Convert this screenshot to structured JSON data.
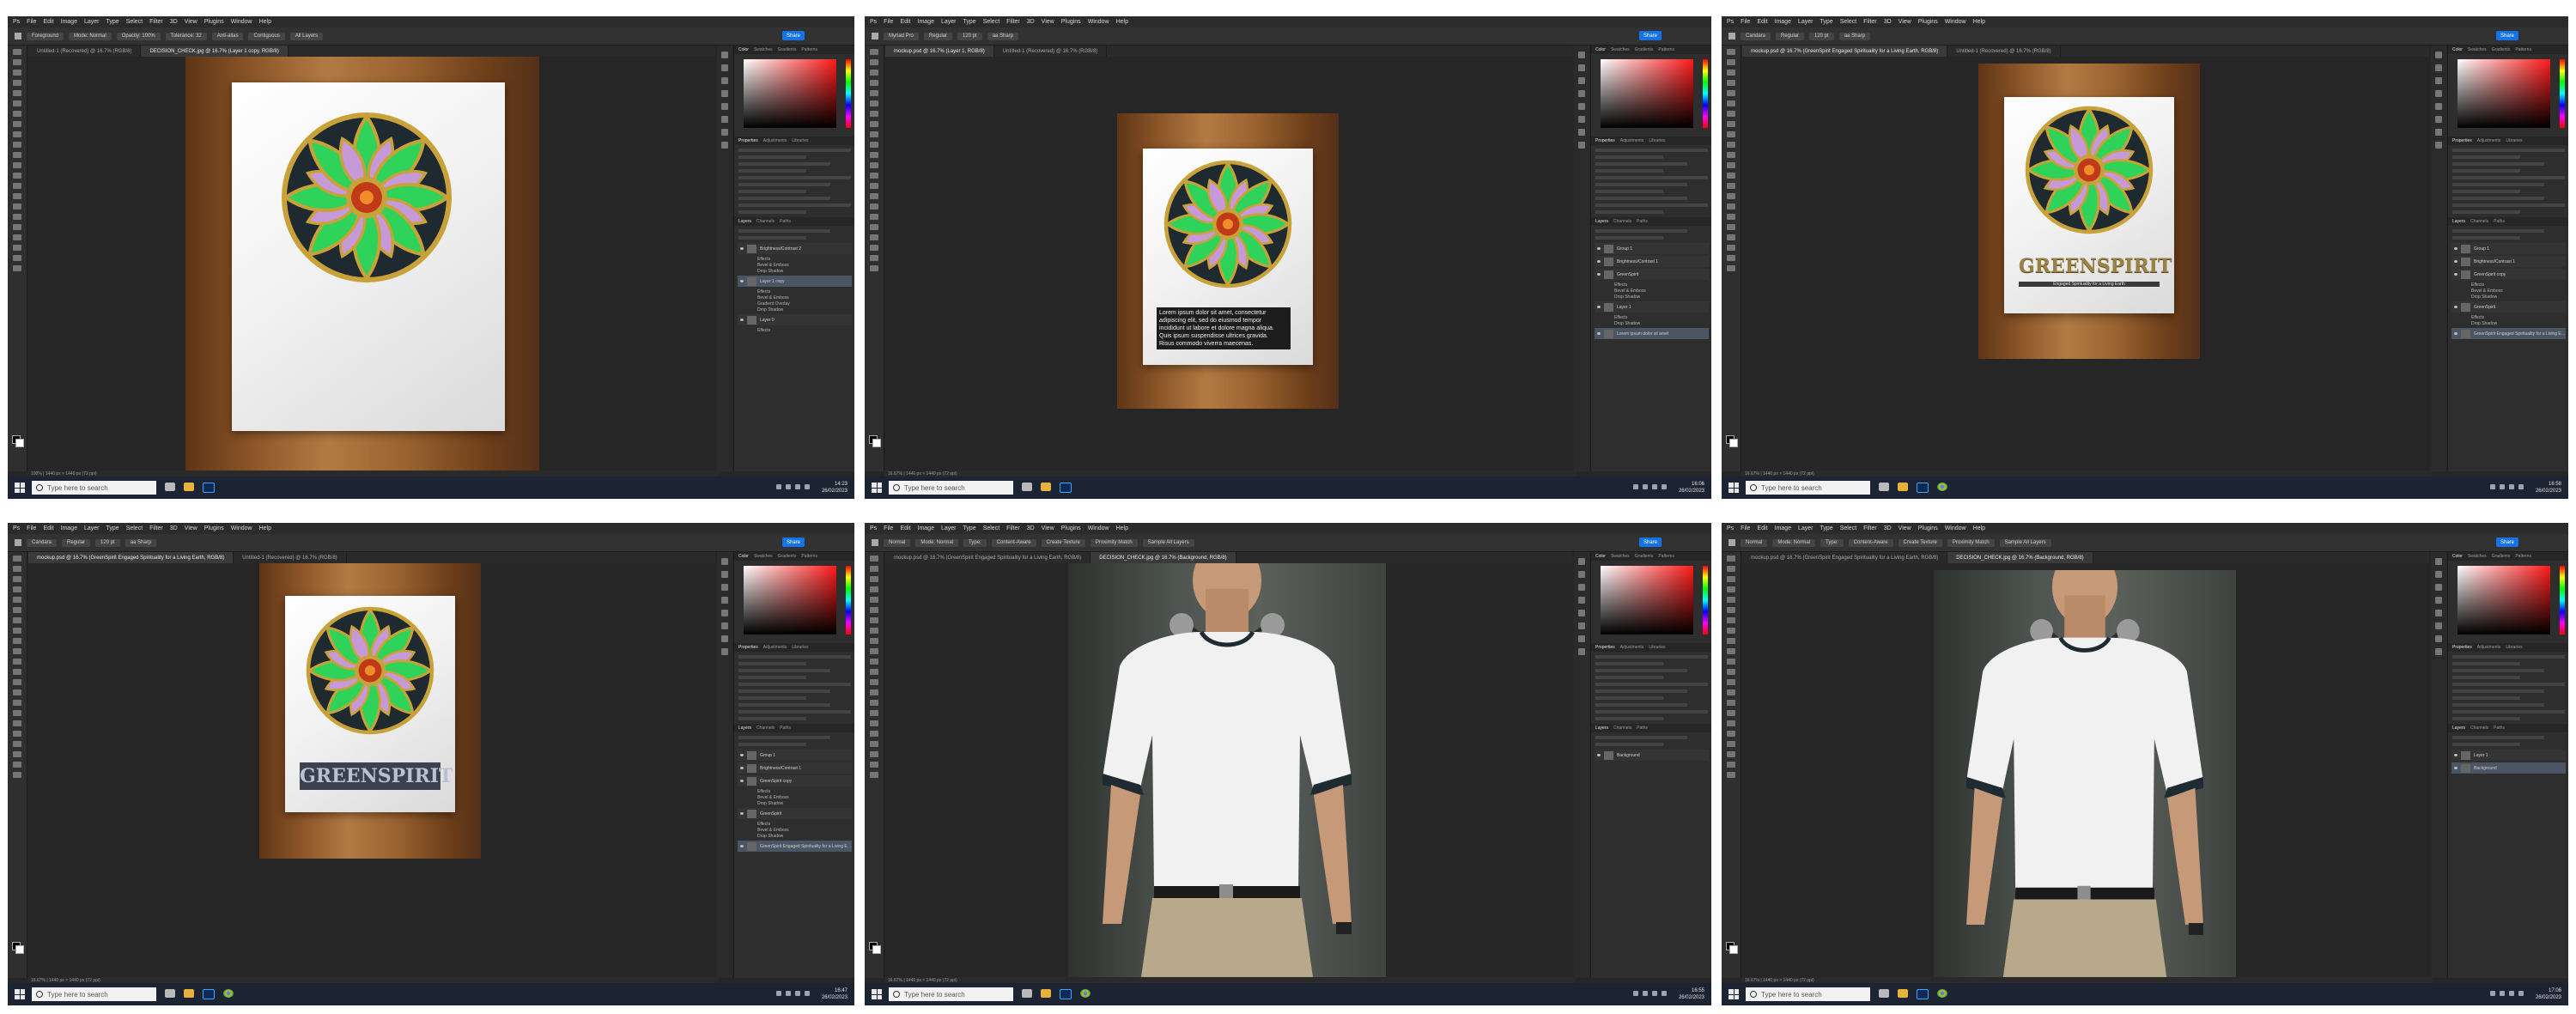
{
  "screenshots": [
    {
      "layout_id": "tl",
      "menu": [
        "Ps",
        "File",
        "Edit",
        "Image",
        "Layer",
        "Type",
        "Select",
        "Filter",
        "3D",
        "View",
        "Plugins",
        "Window",
        "Help"
      ],
      "options": [
        "Foreground",
        "Mode: Normal",
        "Opacity: 100%",
        "Tolerance: 32",
        "Anti-alias",
        "Contiguous",
        "All Layers"
      ],
      "share": "Share",
      "tabs": [
        "Untitled-1 (Recovered) @ 16.7% (RGB/8)",
        "DECISION_CHECK.jpg @ 16.7% (Layer 1 copy, RGB/8)"
      ],
      "active_tab": 1,
      "status": "100% | 1440 px × 1440 px (72 ppi)",
      "panel_tabs": [
        "Color",
        "Swatches",
        "Gradients",
        "Patterns"
      ],
      "props_tabs": [
        "Properties",
        "Adjustments",
        "Libraries"
      ],
      "layer_tabs": [
        "Layers",
        "Channels",
        "Paths"
      ],
      "layers": [
        {
          "name": "Brightness/Contrast 2",
          "sel": false
        },
        {
          "name": "Effects",
          "sub": true
        },
        {
          "name": "Bevel & Emboss",
          "sub": true
        },
        {
          "name": "Drop Shadow",
          "sub": true
        },
        {
          "name": "Layer 1 copy",
          "sel": true
        },
        {
          "name": "Effects",
          "sub": true
        },
        {
          "name": "Bevel & Emboss",
          "sub": true
        },
        {
          "name": "Gradient Overlay",
          "sub": true
        },
        {
          "name": "Drop Shadow",
          "sub": true
        },
        {
          "name": "Layer 0",
          "sel": false
        },
        {
          "name": "Effects",
          "sub": true
        }
      ],
      "time": "14:23",
      "date": "26/02/2023"
    },
    {
      "layout_id": "tm",
      "menu": [
        "Ps",
        "File",
        "Edit",
        "Image",
        "Layer",
        "Type",
        "Select",
        "Filter",
        "3D",
        "View",
        "Plugins",
        "Window",
        "Help"
      ],
      "options": [
        "Myriad Pro",
        "Regular",
        "120 pt",
        "aa Sharp"
      ],
      "share": "Share",
      "tabs": [
        "mockup.psd @ 16.7% (Layer 1, RGB/8)",
        "Untitled-1 (Recovered) @ 16.7% (RGB/8)"
      ],
      "active_tab": 0,
      "status": "16.67% | 1440 px × 1440 px (72 ppi)",
      "panel_tabs": [
        "Color",
        "Swatches",
        "Gradients",
        "Patterns"
      ],
      "props_tabs": [
        "Properties",
        "Adjustments",
        "Libraries"
      ],
      "layer_tabs": [
        "Layers",
        "Channels",
        "Paths"
      ],
      "lorem": "Lorem ipsum dolor sit amet, consectetur\nadipiscing elit, sed do eiusmod tempor\nincididunt ut labore et dolore magna aliqua.\nQuis ipsum suspendisse ultrices gravida.\nRisus commodo viverra maecenas.",
      "layers": [
        {
          "name": "Group 1",
          "sel": false
        },
        {
          "name": "Brightness/Contrast 1",
          "sel": false
        },
        {
          "name": "GreenSpirit",
          "sel": false
        },
        {
          "name": "Effects",
          "sub": true
        },
        {
          "name": "Bevel & Emboss",
          "sub": true
        },
        {
          "name": "Drop Shadow",
          "sub": true
        },
        {
          "name": "Layer 1",
          "sel": false
        },
        {
          "name": "Effects",
          "sub": true
        },
        {
          "name": "Drop Shadow",
          "sub": true
        },
        {
          "name": "Lorem ipsum dolor sit amet",
          "sel": true
        }
      ],
      "time": "16:06",
      "date": "26/02/2023"
    },
    {
      "layout_id": "tr",
      "menu": [
        "Ps",
        "File",
        "Edit",
        "Image",
        "Layer",
        "Type",
        "Select",
        "Filter",
        "3D",
        "View",
        "Plugins",
        "Window",
        "Help"
      ],
      "options": [
        "Candara",
        "Regular",
        "120 pt",
        "aa Sharp"
      ],
      "share": "Share",
      "tabs": [
        "mockup.psd @ 16.7% (GreenSpirit Engaged Spirituality for a Living Earth, RGB/8)",
        "Untitled-1 (Recovered) @ 16.7% (RGB/8)"
      ],
      "active_tab": 0,
      "status": "16.67% | 1440 px × 1440 px (72 ppi)",
      "panel_tabs": [
        "Color",
        "Swatches",
        "Gradients",
        "Patterns"
      ],
      "props_tabs": [
        "Properties",
        "Adjustments",
        "Libraries"
      ],
      "layer_tabs": [
        "Layers",
        "Channels",
        "Paths"
      ],
      "title": "GREENSPIRIT",
      "subtitle": "Engaged Spirituality for a Living Earth",
      "layers": [
        {
          "name": "Group 1",
          "sel": false
        },
        {
          "name": "Brightness/Contrast 1",
          "sel": false
        },
        {
          "name": "GreenSpirit copy",
          "sel": false
        },
        {
          "name": "Effects",
          "sub": true
        },
        {
          "name": "Bevel & Emboss",
          "sub": true
        },
        {
          "name": "Drop Shadow",
          "sub": true
        },
        {
          "name": "GreenSpirit",
          "sel": false
        },
        {
          "name": "Effects",
          "sub": true
        },
        {
          "name": "Drop Shadow",
          "sub": true
        },
        {
          "name": "GreenSpirit Engaged Spirituality for a Living Earth",
          "sel": true
        }
      ],
      "time": "16:58",
      "date": "26/02/2023"
    },
    {
      "layout_id": "bl",
      "menu": [
        "Ps",
        "File",
        "Edit",
        "Image",
        "Layer",
        "Type",
        "Select",
        "Filter",
        "3D",
        "View",
        "Plugins",
        "Window",
        "Help"
      ],
      "options": [
        "Candara",
        "Regular",
        "120 pt",
        "aa Sharp"
      ],
      "share": "Share",
      "tabs": [
        "mockup.psd @ 16.7% (GreenSpirit Engaged Spirituality for a Living Earth, RGB/8)",
        "Untitled-1 (Recovered) @ 16.7% (RGB/8)"
      ],
      "active_tab": 0,
      "status": "16.67% | 1440 px × 1440 px (72 ppi)",
      "panel_tabs": [
        "Color",
        "Swatches",
        "Gradients",
        "Patterns"
      ],
      "props_tabs": [
        "Properties",
        "Adjustments",
        "Libraries"
      ],
      "layer_tabs": [
        "Layers",
        "Channels",
        "Paths"
      ],
      "title": "GREENSPIRIT",
      "subtitle": "",
      "layers": [
        {
          "name": "Group 1",
          "sel": false
        },
        {
          "name": "Brightness/Contrast 1",
          "sel": false
        },
        {
          "name": "GreenSpirit copy",
          "sel": false
        },
        {
          "name": "Effects",
          "sub": true
        },
        {
          "name": "Bevel & Emboss",
          "sub": true
        },
        {
          "name": "Drop Shadow",
          "sub": true
        },
        {
          "name": "GreenSpirit",
          "sel": false
        },
        {
          "name": "Effects",
          "sub": true
        },
        {
          "name": "Bevel & Emboss",
          "sub": true
        },
        {
          "name": "Drop Shadow",
          "sub": true
        },
        {
          "name": "GreenSpirit Engaged Spirituality for a Living Earth",
          "sel": true
        }
      ],
      "time": "16:47",
      "date": "26/02/2023"
    },
    {
      "layout_id": "bm",
      "menu": [
        "Ps",
        "File",
        "Edit",
        "Image",
        "Layer",
        "Type",
        "Select",
        "Filter",
        "3D",
        "View",
        "Plugins",
        "Window",
        "Help"
      ],
      "options": [
        "Normal",
        "Mode: Normal",
        "Type:",
        "Content-Aware",
        "Create Texture",
        "Proximity Match",
        "Sample All Layers"
      ],
      "share": "Share",
      "tabs": [
        "mockup.psd @ 16.7% (GreenSpirit Engaged Spirituality for a Living Earth, RGB/8)",
        "DECISION_CHECK.jpg @ 16.7% (Background, RGB/8)"
      ],
      "active_tab": 1,
      "status": "16.67% | 1440 px × 1440 px (72 ppi)",
      "panel_tabs": [
        "Color",
        "Swatches",
        "Gradients",
        "Patterns"
      ],
      "props_tabs": [
        "Properties",
        "Adjustments",
        "Libraries"
      ],
      "layer_tabs": [
        "Layers",
        "Channels",
        "Paths"
      ],
      "layers": [
        {
          "name": "Background",
          "sel": false
        }
      ],
      "time": "16:55",
      "date": "26/02/2023"
    },
    {
      "layout_id": "br",
      "menu": [
        "Ps",
        "File",
        "Edit",
        "Image",
        "Layer",
        "Type",
        "Select",
        "Filter",
        "3D",
        "View",
        "Plugins",
        "Window",
        "Help"
      ],
      "options": [
        "Normal",
        "Mode: Normal",
        "Type:",
        "Content-Aware",
        "Create Texture",
        "Proximity Match",
        "Sample All Layers"
      ],
      "share": "Share",
      "tabs": [
        "mockup.psd @ 16.7% (GreenSpirit Engaged Spirituality for a Living Earth, RGB/8)",
        "DECISION_CHECK.jpg @ 16.7% (Background, RGB/8)"
      ],
      "active_tab": 1,
      "status": "16.67% | 1440 px × 1440 px (72 ppi)",
      "panel_tabs": [
        "Color",
        "Swatches",
        "Gradients",
        "Patterns"
      ],
      "props_tabs": [
        "Properties",
        "Adjustments",
        "Libraries"
      ],
      "layer_tabs": [
        "Layers",
        "Channels",
        "Paths"
      ],
      "layers": [
        {
          "name": "Layer 1",
          "sel": false
        },
        {
          "name": "Background",
          "sel": true
        }
      ],
      "time": "17:06",
      "date": "26/02/2023"
    }
  ],
  "taskbar": {
    "search_placeholder": "Type here to search"
  },
  "colors": {
    "accent": "#1473e6",
    "wood": "#8a5427",
    "mandala_green": "#2fd35a",
    "mandala_purple": "#c69ad9",
    "title_gold": "#b49a58"
  }
}
